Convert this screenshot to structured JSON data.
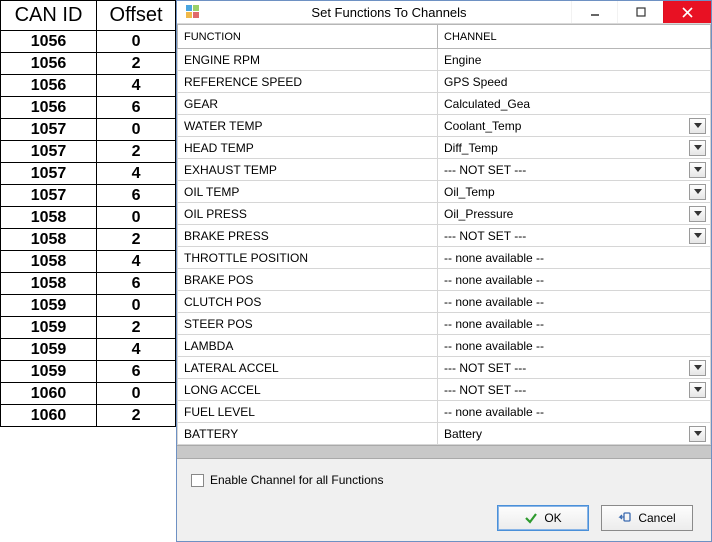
{
  "left_table": {
    "headers": {
      "canid": "CAN ID",
      "offset": "Offset"
    },
    "rows": [
      {
        "canid": "1056",
        "offset": "0"
      },
      {
        "canid": "1056",
        "offset": "2"
      },
      {
        "canid": "1056",
        "offset": "4"
      },
      {
        "canid": "1056",
        "offset": "6"
      },
      {
        "canid": "1057",
        "offset": "0"
      },
      {
        "canid": "1057",
        "offset": "2"
      },
      {
        "canid": "1057",
        "offset": "4"
      },
      {
        "canid": "1057",
        "offset": "6"
      },
      {
        "canid": "1058",
        "offset": "0"
      },
      {
        "canid": "1058",
        "offset": "2"
      },
      {
        "canid": "1058",
        "offset": "4"
      },
      {
        "canid": "1058",
        "offset": "6"
      },
      {
        "canid": "1059",
        "offset": "0"
      },
      {
        "canid": "1059",
        "offset": "2"
      },
      {
        "canid": "1059",
        "offset": "4"
      },
      {
        "canid": "1059",
        "offset": "6"
      },
      {
        "canid": "1060",
        "offset": "0"
      },
      {
        "canid": "1060",
        "offset": "2"
      }
    ]
  },
  "dialog": {
    "title": "Set Functions To Channels",
    "headers": {
      "function": "FUNCTION",
      "channel": "CHANNEL"
    },
    "rows": [
      {
        "function": "ENGINE RPM",
        "channel": "Engine",
        "dropdown": false
      },
      {
        "function": "REFERENCE SPEED",
        "channel": "GPS Speed",
        "dropdown": false
      },
      {
        "function": "GEAR",
        "channel": "Calculated_Gea",
        "dropdown": false
      },
      {
        "function": "WATER TEMP",
        "channel": "Coolant_Temp",
        "dropdown": true
      },
      {
        "function": "HEAD TEMP",
        "channel": "Diff_Temp",
        "dropdown": true
      },
      {
        "function": "EXHAUST TEMP",
        "channel": "--- NOT SET ---",
        "dropdown": true
      },
      {
        "function": "OIL TEMP",
        "channel": "Oil_Temp",
        "dropdown": true
      },
      {
        "function": "OIL  PRESS",
        "channel": "Oil_Pressure",
        "dropdown": true
      },
      {
        "function": "BRAKE PRESS",
        "channel": "--- NOT SET ---",
        "dropdown": true
      },
      {
        "function": "THROTTLE POSITION",
        "channel": "-- none available --",
        "dropdown": false
      },
      {
        "function": "BRAKE POS",
        "channel": "-- none available --",
        "dropdown": false
      },
      {
        "function": "CLUTCH  POS",
        "channel": "-- none available --",
        "dropdown": false
      },
      {
        "function": "STEER POS",
        "channel": "-- none available --",
        "dropdown": false
      },
      {
        "function": "LAMBDA",
        "channel": "-- none available --",
        "dropdown": false
      },
      {
        "function": "LATERAL  ACCEL",
        "channel": "--- NOT SET ---",
        "dropdown": true
      },
      {
        "function": "LONG ACCEL",
        "channel": "--- NOT SET ---",
        "dropdown": true
      },
      {
        "function": "FUEL LEVEL",
        "channel": "-- none available --",
        "dropdown": false
      },
      {
        "function": "BATTERY",
        "channel": "Battery",
        "dropdown": true
      }
    ],
    "checkbox_label": "Enable Channel for all Functions",
    "buttons": {
      "ok": "OK",
      "cancel": "Cancel"
    }
  }
}
